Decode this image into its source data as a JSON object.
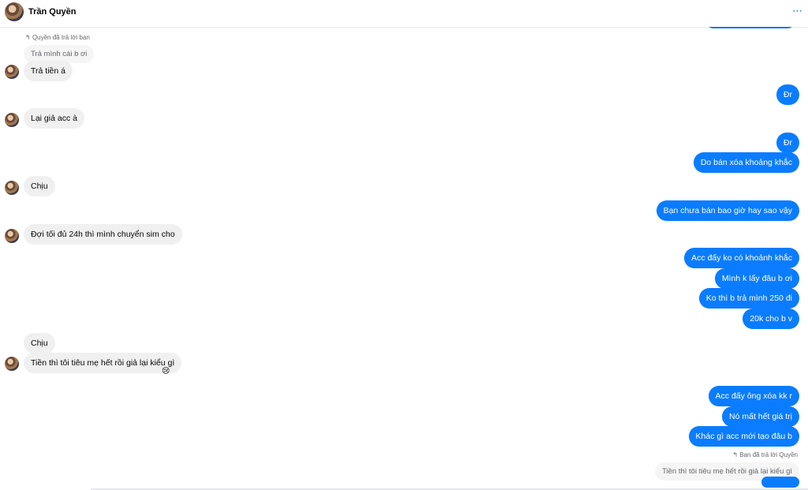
{
  "header": {
    "name": "Trần Quyền",
    "more_icon": "⋯"
  },
  "messages": {
    "reply_note_in": "Quyền đã trả lời bạn",
    "quoted_in": "Trả mình cái b ơi",
    "m1": "Trả tiền á",
    "o1": "Đr",
    "m2": "Lại giả acc à",
    "o2": "Đr",
    "o3": "Do bán xóa khoảng khắc",
    "m3": "Chịu",
    "o4": "Bạn chưa bán bao giờ hay sao vậy",
    "m4": "Đợi tối đủ 24h thì mình chuyển sim cho",
    "o5": "Acc đấy ko có khoảnh khắc",
    "o6": "Mình k lấy đâu b ơi",
    "o7": "Ko thì b trả mình 250 đi",
    "o8": "20k cho b v",
    "m5": "Chịu",
    "m6": "Tiền thì tôi tiêu mẹ hết rồi giả lại kiểu gì",
    "reaction": "😢",
    "o9": "Acc đấy ông xóa kk r",
    "o10": "Nó mất hết giá trị",
    "o11": "Khác gì acc mới tạo đâu b",
    "reply_note_out": "Bạn đã trả lời Quyền",
    "quoted_out": "Tiền thì tôi tiêu mẹ hết rồi giả lại kiểu gì"
  }
}
